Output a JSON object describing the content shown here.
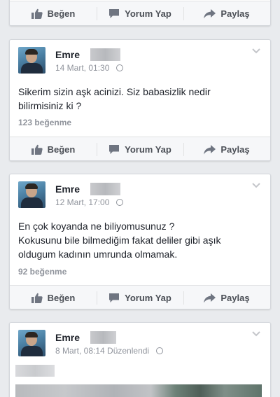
{
  "actions": {
    "like": "Beğen",
    "comment": "Yorum Yap",
    "share": "Paylaş"
  },
  "posts": [
    {
      "author": "Emre",
      "time": "14 Mart, 01:30",
      "text_lines": [
        "Sikerim sizin aşk acinizi. Siz babasizlik nedir",
        "bilirmisiniz ki ?"
      ],
      "likes": "123 beğenme"
    },
    {
      "author": "Emre",
      "time": "12 Mart, 17:00",
      "text_lines": [
        "En çok koyanda ne biliyomusunuz ?",
        "Kokusunu bile  bilmediğim fakat deliler gibi aşık",
        "oldugum kadının umrunda olmamak."
      ],
      "likes": "92 beğenme"
    },
    {
      "author": "Emre",
      "time": "8 Mart, 08:14 Düzenlendi"
    }
  ],
  "icons": [
    "like-thumb-icon",
    "comment-bubble-icon",
    "share-arrow-icon",
    "globe-icon",
    "chevron-down-icon"
  ]
}
